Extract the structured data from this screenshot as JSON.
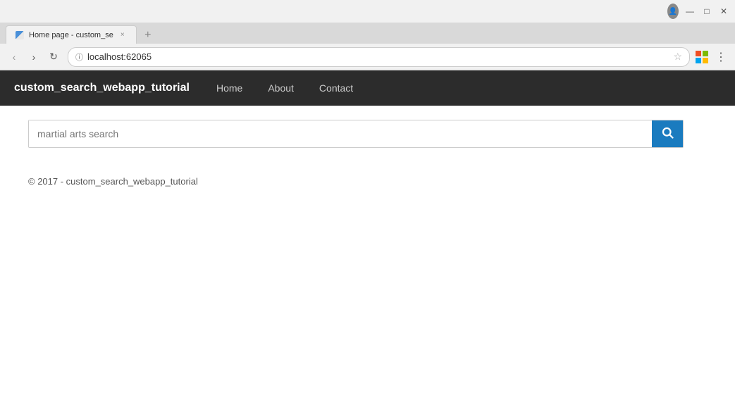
{
  "browser": {
    "tab": {
      "title": "Home page - custom_se",
      "close_label": "×",
      "new_tab_label": "+"
    },
    "nav": {
      "back_label": "‹",
      "forward_label": "›",
      "refresh_label": "↻"
    },
    "address": {
      "url": "localhost:62065",
      "secure_icon": "ⓘ",
      "star_icon": "☆"
    },
    "actions": {
      "menu_label": "⋮",
      "windows_label": "⊞"
    },
    "window_controls": {
      "minimize": "—",
      "maximize": "□",
      "close": "✕"
    }
  },
  "site": {
    "brand": "custom_search_webapp_tutorial",
    "nav": {
      "home": "Home",
      "about": "About",
      "contact": "Contact"
    },
    "search": {
      "placeholder": "martial arts search",
      "button_label": "Search"
    },
    "footer": {
      "text": "© 2017 - custom_search_webapp_tutorial"
    }
  }
}
